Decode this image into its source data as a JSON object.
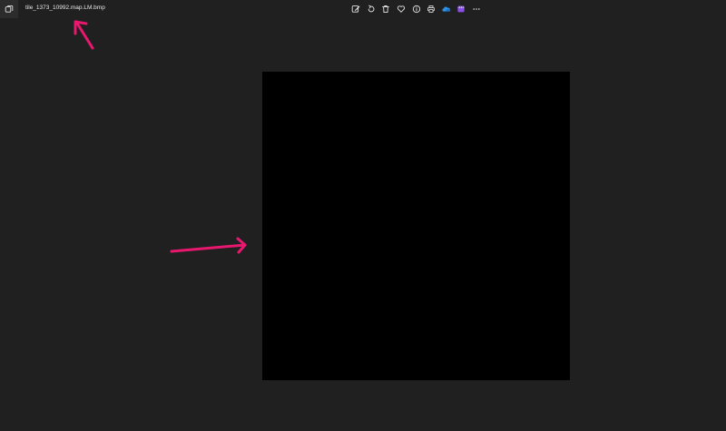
{
  "window": {
    "file_name": "tile_1373_10992.map.LM.bmp"
  },
  "toolbar": {
    "buttons": [
      {
        "name": "edit-image-button",
        "icon": "edit-image-icon"
      },
      {
        "name": "rotate-button",
        "icon": "rotate-icon"
      },
      {
        "name": "delete-button",
        "icon": "trash-icon"
      },
      {
        "name": "favorite-button",
        "icon": "heart-icon"
      },
      {
        "name": "file-info-button",
        "icon": "info-icon"
      },
      {
        "name": "print-button",
        "icon": "print-icon"
      },
      {
        "name": "onedrive-button",
        "icon": "cloud-icon"
      },
      {
        "name": "video-editor-button",
        "icon": "clapperboard-icon"
      },
      {
        "name": "more-options-button",
        "icon": "ellipsis-icon"
      }
    ]
  },
  "colors": {
    "background": "#202020",
    "canvas": "#000000",
    "onedrive_blue": "#2f8fe0",
    "clipchamp_purple": "#8a4fe6",
    "annotation_arrow": "#e8186f"
  }
}
